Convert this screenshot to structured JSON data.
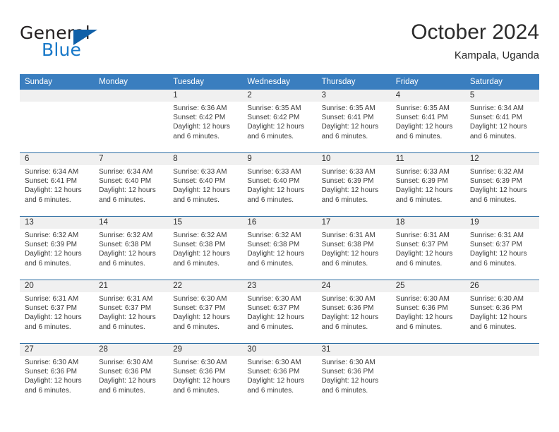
{
  "brand": {
    "name_top": "General",
    "name_bottom": "Blue",
    "colors": {
      "top": "#231f20",
      "bottom": "#1878c8",
      "triangle": "#1060a8"
    }
  },
  "header": {
    "month_title": "October 2024",
    "location": "Kampala, Uganda"
  },
  "theme": {
    "header_bg": "#3a7ebf",
    "row_rule": "#2b6ca3",
    "daynum_bg": "#f0f0f0"
  },
  "weekday_headers": [
    "Sunday",
    "Monday",
    "Tuesday",
    "Wednesday",
    "Thursday",
    "Friday",
    "Saturday"
  ],
  "weeks": [
    [
      {
        "day": "",
        "blank": true,
        "sunrise": "",
        "sunset": "",
        "daylight1": "",
        "daylight2": ""
      },
      {
        "day": "",
        "blank": true,
        "sunrise": "",
        "sunset": "",
        "daylight1": "",
        "daylight2": ""
      },
      {
        "day": "1",
        "blank": false,
        "sunrise": "Sunrise: 6:36 AM",
        "sunset": "Sunset: 6:42 PM",
        "daylight1": "Daylight: 12 hours",
        "daylight2": "and 6 minutes."
      },
      {
        "day": "2",
        "blank": false,
        "sunrise": "Sunrise: 6:35 AM",
        "sunset": "Sunset: 6:42 PM",
        "daylight1": "Daylight: 12 hours",
        "daylight2": "and 6 minutes."
      },
      {
        "day": "3",
        "blank": false,
        "sunrise": "Sunrise: 6:35 AM",
        "sunset": "Sunset: 6:41 PM",
        "daylight1": "Daylight: 12 hours",
        "daylight2": "and 6 minutes."
      },
      {
        "day": "4",
        "blank": false,
        "sunrise": "Sunrise: 6:35 AM",
        "sunset": "Sunset: 6:41 PM",
        "daylight1": "Daylight: 12 hours",
        "daylight2": "and 6 minutes."
      },
      {
        "day": "5",
        "blank": false,
        "sunrise": "Sunrise: 6:34 AM",
        "sunset": "Sunset: 6:41 PM",
        "daylight1": "Daylight: 12 hours",
        "daylight2": "and 6 minutes."
      }
    ],
    [
      {
        "day": "6",
        "blank": false,
        "sunrise": "Sunrise: 6:34 AM",
        "sunset": "Sunset: 6:41 PM",
        "daylight1": "Daylight: 12 hours",
        "daylight2": "and 6 minutes."
      },
      {
        "day": "7",
        "blank": false,
        "sunrise": "Sunrise: 6:34 AM",
        "sunset": "Sunset: 6:40 PM",
        "daylight1": "Daylight: 12 hours",
        "daylight2": "and 6 minutes."
      },
      {
        "day": "8",
        "blank": false,
        "sunrise": "Sunrise: 6:33 AM",
        "sunset": "Sunset: 6:40 PM",
        "daylight1": "Daylight: 12 hours",
        "daylight2": "and 6 minutes."
      },
      {
        "day": "9",
        "blank": false,
        "sunrise": "Sunrise: 6:33 AM",
        "sunset": "Sunset: 6:40 PM",
        "daylight1": "Daylight: 12 hours",
        "daylight2": "and 6 minutes."
      },
      {
        "day": "10",
        "blank": false,
        "sunrise": "Sunrise: 6:33 AM",
        "sunset": "Sunset: 6:39 PM",
        "daylight1": "Daylight: 12 hours",
        "daylight2": "and 6 minutes."
      },
      {
        "day": "11",
        "blank": false,
        "sunrise": "Sunrise: 6:33 AM",
        "sunset": "Sunset: 6:39 PM",
        "daylight1": "Daylight: 12 hours",
        "daylight2": "and 6 minutes."
      },
      {
        "day": "12",
        "blank": false,
        "sunrise": "Sunrise: 6:32 AM",
        "sunset": "Sunset: 6:39 PM",
        "daylight1": "Daylight: 12 hours",
        "daylight2": "and 6 minutes."
      }
    ],
    [
      {
        "day": "13",
        "blank": false,
        "sunrise": "Sunrise: 6:32 AM",
        "sunset": "Sunset: 6:39 PM",
        "daylight1": "Daylight: 12 hours",
        "daylight2": "and 6 minutes."
      },
      {
        "day": "14",
        "blank": false,
        "sunrise": "Sunrise: 6:32 AM",
        "sunset": "Sunset: 6:38 PM",
        "daylight1": "Daylight: 12 hours",
        "daylight2": "and 6 minutes."
      },
      {
        "day": "15",
        "blank": false,
        "sunrise": "Sunrise: 6:32 AM",
        "sunset": "Sunset: 6:38 PM",
        "daylight1": "Daylight: 12 hours",
        "daylight2": "and 6 minutes."
      },
      {
        "day": "16",
        "blank": false,
        "sunrise": "Sunrise: 6:32 AM",
        "sunset": "Sunset: 6:38 PM",
        "daylight1": "Daylight: 12 hours",
        "daylight2": "and 6 minutes."
      },
      {
        "day": "17",
        "blank": false,
        "sunrise": "Sunrise: 6:31 AM",
        "sunset": "Sunset: 6:38 PM",
        "daylight1": "Daylight: 12 hours",
        "daylight2": "and 6 minutes."
      },
      {
        "day": "18",
        "blank": false,
        "sunrise": "Sunrise: 6:31 AM",
        "sunset": "Sunset: 6:37 PM",
        "daylight1": "Daylight: 12 hours",
        "daylight2": "and 6 minutes."
      },
      {
        "day": "19",
        "blank": false,
        "sunrise": "Sunrise: 6:31 AM",
        "sunset": "Sunset: 6:37 PM",
        "daylight1": "Daylight: 12 hours",
        "daylight2": "and 6 minutes."
      }
    ],
    [
      {
        "day": "20",
        "blank": false,
        "sunrise": "Sunrise: 6:31 AM",
        "sunset": "Sunset: 6:37 PM",
        "daylight1": "Daylight: 12 hours",
        "daylight2": "and 6 minutes."
      },
      {
        "day": "21",
        "blank": false,
        "sunrise": "Sunrise: 6:31 AM",
        "sunset": "Sunset: 6:37 PM",
        "daylight1": "Daylight: 12 hours",
        "daylight2": "and 6 minutes."
      },
      {
        "day": "22",
        "blank": false,
        "sunrise": "Sunrise: 6:30 AM",
        "sunset": "Sunset: 6:37 PM",
        "daylight1": "Daylight: 12 hours",
        "daylight2": "and 6 minutes."
      },
      {
        "day": "23",
        "blank": false,
        "sunrise": "Sunrise: 6:30 AM",
        "sunset": "Sunset: 6:37 PM",
        "daylight1": "Daylight: 12 hours",
        "daylight2": "and 6 minutes."
      },
      {
        "day": "24",
        "blank": false,
        "sunrise": "Sunrise: 6:30 AM",
        "sunset": "Sunset: 6:36 PM",
        "daylight1": "Daylight: 12 hours",
        "daylight2": "and 6 minutes."
      },
      {
        "day": "25",
        "blank": false,
        "sunrise": "Sunrise: 6:30 AM",
        "sunset": "Sunset: 6:36 PM",
        "daylight1": "Daylight: 12 hours",
        "daylight2": "and 6 minutes."
      },
      {
        "day": "26",
        "blank": false,
        "sunrise": "Sunrise: 6:30 AM",
        "sunset": "Sunset: 6:36 PM",
        "daylight1": "Daylight: 12 hours",
        "daylight2": "and 6 minutes."
      }
    ],
    [
      {
        "day": "27",
        "blank": false,
        "sunrise": "Sunrise: 6:30 AM",
        "sunset": "Sunset: 6:36 PM",
        "daylight1": "Daylight: 12 hours",
        "daylight2": "and 6 minutes."
      },
      {
        "day": "28",
        "blank": false,
        "sunrise": "Sunrise: 6:30 AM",
        "sunset": "Sunset: 6:36 PM",
        "daylight1": "Daylight: 12 hours",
        "daylight2": "and 6 minutes."
      },
      {
        "day": "29",
        "blank": false,
        "sunrise": "Sunrise: 6:30 AM",
        "sunset": "Sunset: 6:36 PM",
        "daylight1": "Daylight: 12 hours",
        "daylight2": "and 6 minutes."
      },
      {
        "day": "30",
        "blank": false,
        "sunrise": "Sunrise: 6:30 AM",
        "sunset": "Sunset: 6:36 PM",
        "daylight1": "Daylight: 12 hours",
        "daylight2": "and 6 minutes."
      },
      {
        "day": "31",
        "blank": false,
        "sunrise": "Sunrise: 6:30 AM",
        "sunset": "Sunset: 6:36 PM",
        "daylight1": "Daylight: 12 hours",
        "daylight2": "and 6 minutes."
      },
      {
        "day": "",
        "blank": true,
        "sunrise": "",
        "sunset": "",
        "daylight1": "",
        "daylight2": ""
      },
      {
        "day": "",
        "blank": true,
        "sunrise": "",
        "sunset": "",
        "daylight1": "",
        "daylight2": ""
      }
    ]
  ]
}
